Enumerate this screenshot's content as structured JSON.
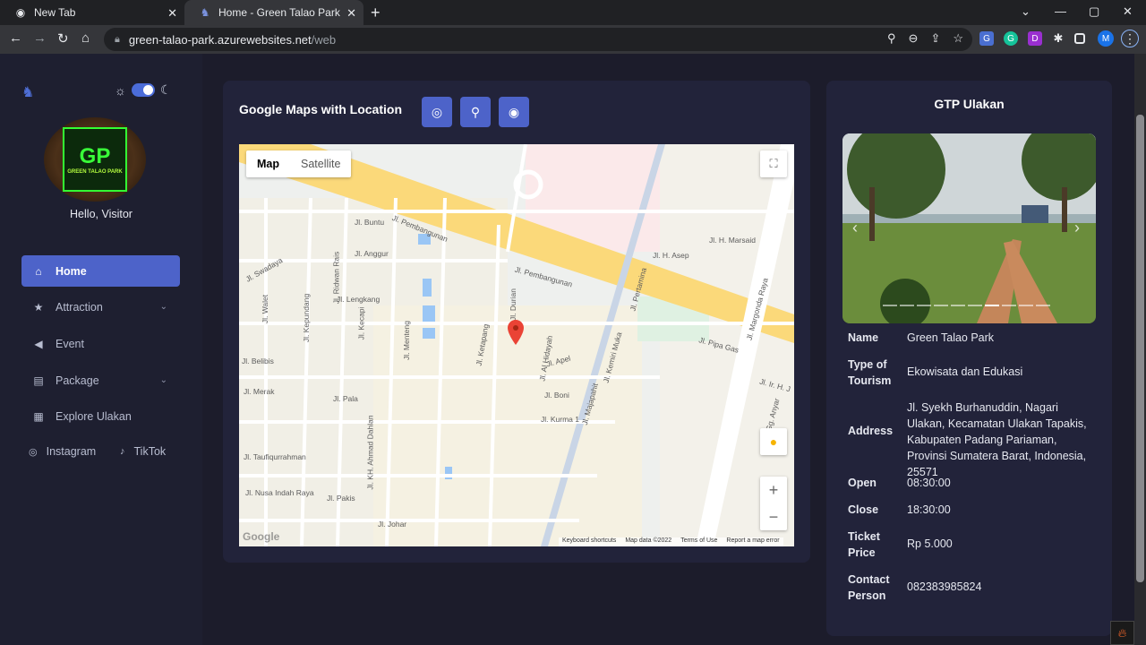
{
  "browser": {
    "tabs": [
      {
        "title": "New Tab",
        "icon": "chrome-icon"
      },
      {
        "title": "Home - Green Talao Park",
        "icon": "site-icon"
      }
    ],
    "url_host": "green-talao-park.azurewebsites.net",
    "url_path": "/web",
    "profile_initial": "M"
  },
  "sidebar": {
    "greeting": "Hello, Visitor",
    "logo_brand": "GREEN TALAO PARK",
    "logo_letters": "GP",
    "menu": [
      {
        "label": "Home",
        "icon": "home-icon",
        "active": true
      },
      {
        "label": "Attraction",
        "icon": "star-icon",
        "has_submenu": true
      },
      {
        "label": "Event",
        "icon": "megaphone-icon"
      },
      {
        "label": "Package",
        "icon": "package-icon",
        "has_submenu": true
      },
      {
        "label": "Explore Ulakan",
        "icon": "map-icon"
      }
    ],
    "social": [
      {
        "label": "Instagram",
        "icon": "instagram-icon"
      },
      {
        "label": "TikTok",
        "icon": "tiktok-icon"
      }
    ]
  },
  "map_card": {
    "title": "Google Maps with Location",
    "buttons": [
      "locate-icon",
      "pin-icon",
      "eye-icon"
    ],
    "map_type": {
      "map": "Map",
      "satellite": "Satellite"
    },
    "footer": [
      "Keyboard shortcuts",
      "Map data ©2022",
      "Terms of Use",
      "Report a map error"
    ],
    "google": "Google",
    "streets": [
      "Jl. Buntu",
      "Jl. Pembangunan",
      "Jl. Anggur",
      "Jl. Swadaya",
      "Jl. Ridwan Rais",
      "Jl. Lengkang",
      "Jl. Walet",
      "Jl. Kepundang",
      "Jl. Kecapi",
      "Jl. Menteng",
      "Jl. Ketapang",
      "Jl. Durian",
      "Jl. Pembangunan",
      "Jl. Al Hidayah",
      "Jl. Apel",
      "Jl. Belibis",
      "Jl. Merak",
      "Jl. Pala",
      "Jl. Boni",
      "Jl. Kurma 1",
      "Jl. Taufiqurrahman",
      "Jl. KH. Ahmad Dahlan",
      "Jl. Nusa Indah Raya",
      "Jl. Pakis",
      "Jl. Johar",
      "Jl. Margonda Raya",
      "Jl. H. Marsaid",
      "Jl. H. Asep",
      "Jl. Pertamina",
      "Jl. Kemiri Muka",
      "Jl. Majapahit",
      "Jl. Pipa Gas",
      "Jl. Ir. H. J",
      "Gg. Anyar"
    ]
  },
  "info_card": {
    "title": "GTP Ulakan",
    "rows": [
      {
        "label": "Name",
        "value": "Green Talao Park"
      },
      {
        "label": "Type of Tourism",
        "value": "Ekowisata dan Edukasi"
      },
      {
        "label": "Address",
        "value": "Jl. Syekh Burhanuddin, Nagari Ulakan, Kecamatan Ulakan Tapakis, Kabupaten Padang Pariaman, Provinsi Sumatera Barat, Indonesia, 25571"
      },
      {
        "label": "Open",
        "value": "08:30:00"
      },
      {
        "label": "Close",
        "value": "18:30:00"
      },
      {
        "label": "Ticket Price",
        "value": "Rp 5.000"
      },
      {
        "label": "Contact Person",
        "value": "082383985824"
      }
    ],
    "carousel": {
      "slides": 10,
      "active": 6
    }
  }
}
